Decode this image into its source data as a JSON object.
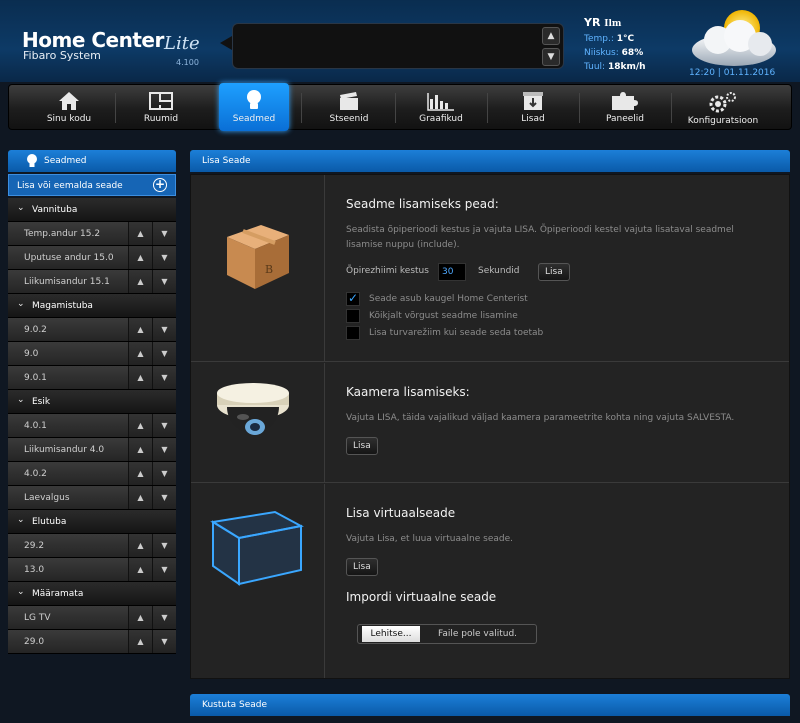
{
  "header": {
    "logo_main": "Home Center",
    "logo_lite": "Lite",
    "logo_sub": "Fibaro System",
    "version": "4.100",
    "message_up": "▲",
    "message_down": "▼"
  },
  "weather": {
    "provider": "YR",
    "provider_sub": "Ilm",
    "temp_label": "Temp.:",
    "temp_value": "1°C",
    "humidity_label": "Niiskus:",
    "humidity_value": "68%",
    "wind_label": "Tuul:",
    "wind_value": "18km/h",
    "datetime": "12:20 | 01.11.2016"
  },
  "nav": [
    {
      "label": "Sinu kodu",
      "icon": "home-icon"
    },
    {
      "label": "Ruumid",
      "icon": "rooms-icon"
    },
    {
      "label": "Seadmed",
      "icon": "bulb-icon",
      "active": true
    },
    {
      "label": "Stseenid",
      "icon": "clapper-icon"
    },
    {
      "label": "Graafikud",
      "icon": "chart-icon"
    },
    {
      "label": "Lisad",
      "icon": "box-icon"
    },
    {
      "label": "Paneelid",
      "icon": "puzzle-icon"
    },
    {
      "label": "Konfiguratsioon",
      "icon": "gears-icon"
    }
  ],
  "sidebar": {
    "title": "Seadmed",
    "add_label": "Lisa või eemalda seade",
    "plus": "+",
    "groups": [
      {
        "name": "Vannituba",
        "devices": [
          "Temp.andur 15.2",
          "Uputuse andur 15.0",
          "Liikumisandur 15.1"
        ]
      },
      {
        "name": "Magamistuba",
        "devices": [
          "9.0.2",
          "9.0",
          "9.0.1"
        ]
      },
      {
        "name": "Esik",
        "devices": [
          "4.0.1",
          "Liikumisandur 4.0",
          "4.0.2",
          "Laevalgus"
        ]
      },
      {
        "name": "Elutuba",
        "devices": [
          "29.2",
          "13.0"
        ]
      },
      {
        "name": "Määramata",
        "devices": [
          "LG TV",
          "29.0"
        ]
      }
    ]
  },
  "panel": {
    "title": "Lisa Seade",
    "add_device": {
      "heading": "Seadme lisamiseks pead:",
      "text1": "Seadista õpiperioodi kestus ja vajuta LISA. Õpiperioodi kestel vajuta lisataval seadmel",
      "text2": "lisamise nuppu (include).",
      "learn_label": "Õpirezhiimi kestus",
      "learn_value": "30",
      "seconds_label": "Sekundid",
      "add_button": "Lisa",
      "options": [
        {
          "label": "Seade asub kaugel Home Centerist",
          "checked": true
        },
        {
          "label": "Kõikjalt võrgust seadme lisamine",
          "checked": false
        },
        {
          "label": "Lisa turvarežiim kui seade seda toetab",
          "checked": false
        }
      ]
    },
    "camera": {
      "heading": "Kaamera lisamiseks:",
      "text": "Vajuta LISA, täida vajalikud väljad kaamera parameetrite kohta ning vajuta SALVESTA.",
      "add_button": "Lisa"
    },
    "virtual": {
      "heading": "Lisa virtuaalseade",
      "text": "Vajuta Lisa, et luua virtuaalne seade.",
      "add_button": "Lisa",
      "import_heading": "Impordi virtuaalne seade",
      "browse_button": "Lehitse...",
      "no_file": "Faile pole valitud."
    }
  },
  "panel2": {
    "title": "Kustuta Seade"
  },
  "colors": {
    "accent": "#1a8cff",
    "panel_bg": "#232323",
    "header_bg": "#0d3a66"
  }
}
